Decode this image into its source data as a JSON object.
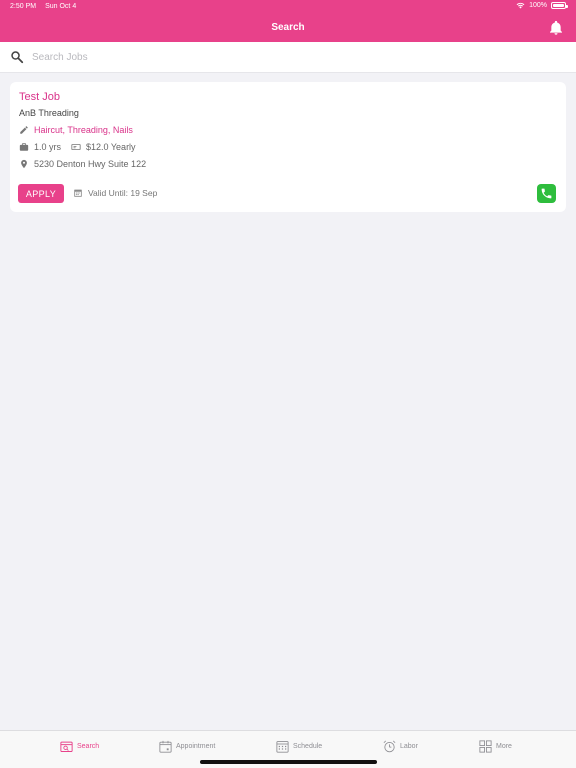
{
  "status_bar": {
    "time": "2:50 PM",
    "date": "Sun Oct 4",
    "battery": "100%",
    "battery_level": 1.0,
    "icons": [
      "wifi-icon",
      "battery-icon"
    ]
  },
  "header": {
    "title": "Search",
    "background_color": "#e8418a",
    "right_icon": "bell-icon"
  },
  "search": {
    "placeholder": "Search Jobs",
    "value": "",
    "icon": "search-icon"
  },
  "jobs": [
    {
      "title": "Test Job",
      "company": "AnB Threading",
      "skills": "Haircut, Threading, Nails",
      "experience": "1.0 yrs",
      "salary": "$12.0 Yearly",
      "address": "5230 Denton Hwy Suite 122",
      "apply_label": "APPLY",
      "valid_until": "Valid Until: 19 Sep",
      "icons": [
        "pencil-icon",
        "briefcase-icon",
        "money-icon",
        "location-pin-icon",
        "calendar-icon",
        "phone-icon"
      ]
    }
  ],
  "tabs": [
    {
      "label": "Search",
      "icon": "search-tab-icon",
      "active": true
    },
    {
      "label": "Appointment",
      "icon": "calendar-tab-icon",
      "active": false
    },
    {
      "label": "Schedule",
      "icon": "schedule-tab-icon",
      "active": false
    },
    {
      "label": "Labor",
      "icon": "alarm-clock-icon",
      "active": false
    },
    {
      "label": "More",
      "icon": "grid-icon",
      "active": false
    }
  ],
  "colors": {
    "accent": "#e8418a",
    "title_text": "#d9338a",
    "phone_green": "#2ebd3d",
    "background": "#f2f2f6"
  }
}
